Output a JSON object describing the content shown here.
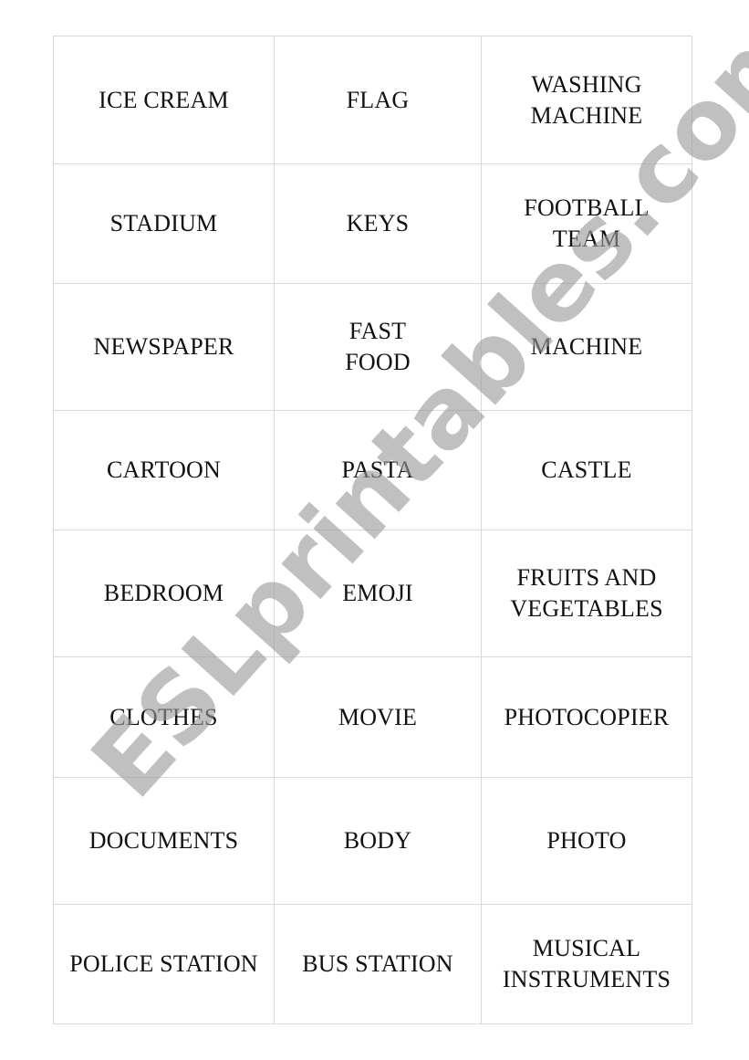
{
  "document": {
    "type": "word-cards-grid",
    "rows": [
      [
        "ICE CREAM",
        "FLAG",
        "WASHING\nMACHINE"
      ],
      [
        "STADIUM",
        "KEYS",
        "FOOTBALL\nTEAM"
      ],
      [
        "NEWSPAPER",
        "FAST\nFOOD",
        "MACHINE"
      ],
      [
        "CARTOON",
        "PASTA",
        "CASTLE"
      ],
      [
        "BEDROOM",
        "EMOJI",
        "FRUITS AND\nVEGETABLES"
      ],
      [
        "CLOTHES",
        "MOVIE",
        "PHOTOCOPIER"
      ],
      [
        "DOCUMENTS",
        "BODY",
        "PHOTO"
      ],
      [
        "POLICE STATION",
        "BUS STATION",
        "MUSICAL\nINSTRUMENTS"
      ]
    ]
  },
  "watermark": {
    "text": "ESLprintables.com",
    "color": "#9a9a9a"
  },
  "colors": {
    "border": "#d9d9d9",
    "text": "#111111",
    "background": "#ffffff"
  }
}
